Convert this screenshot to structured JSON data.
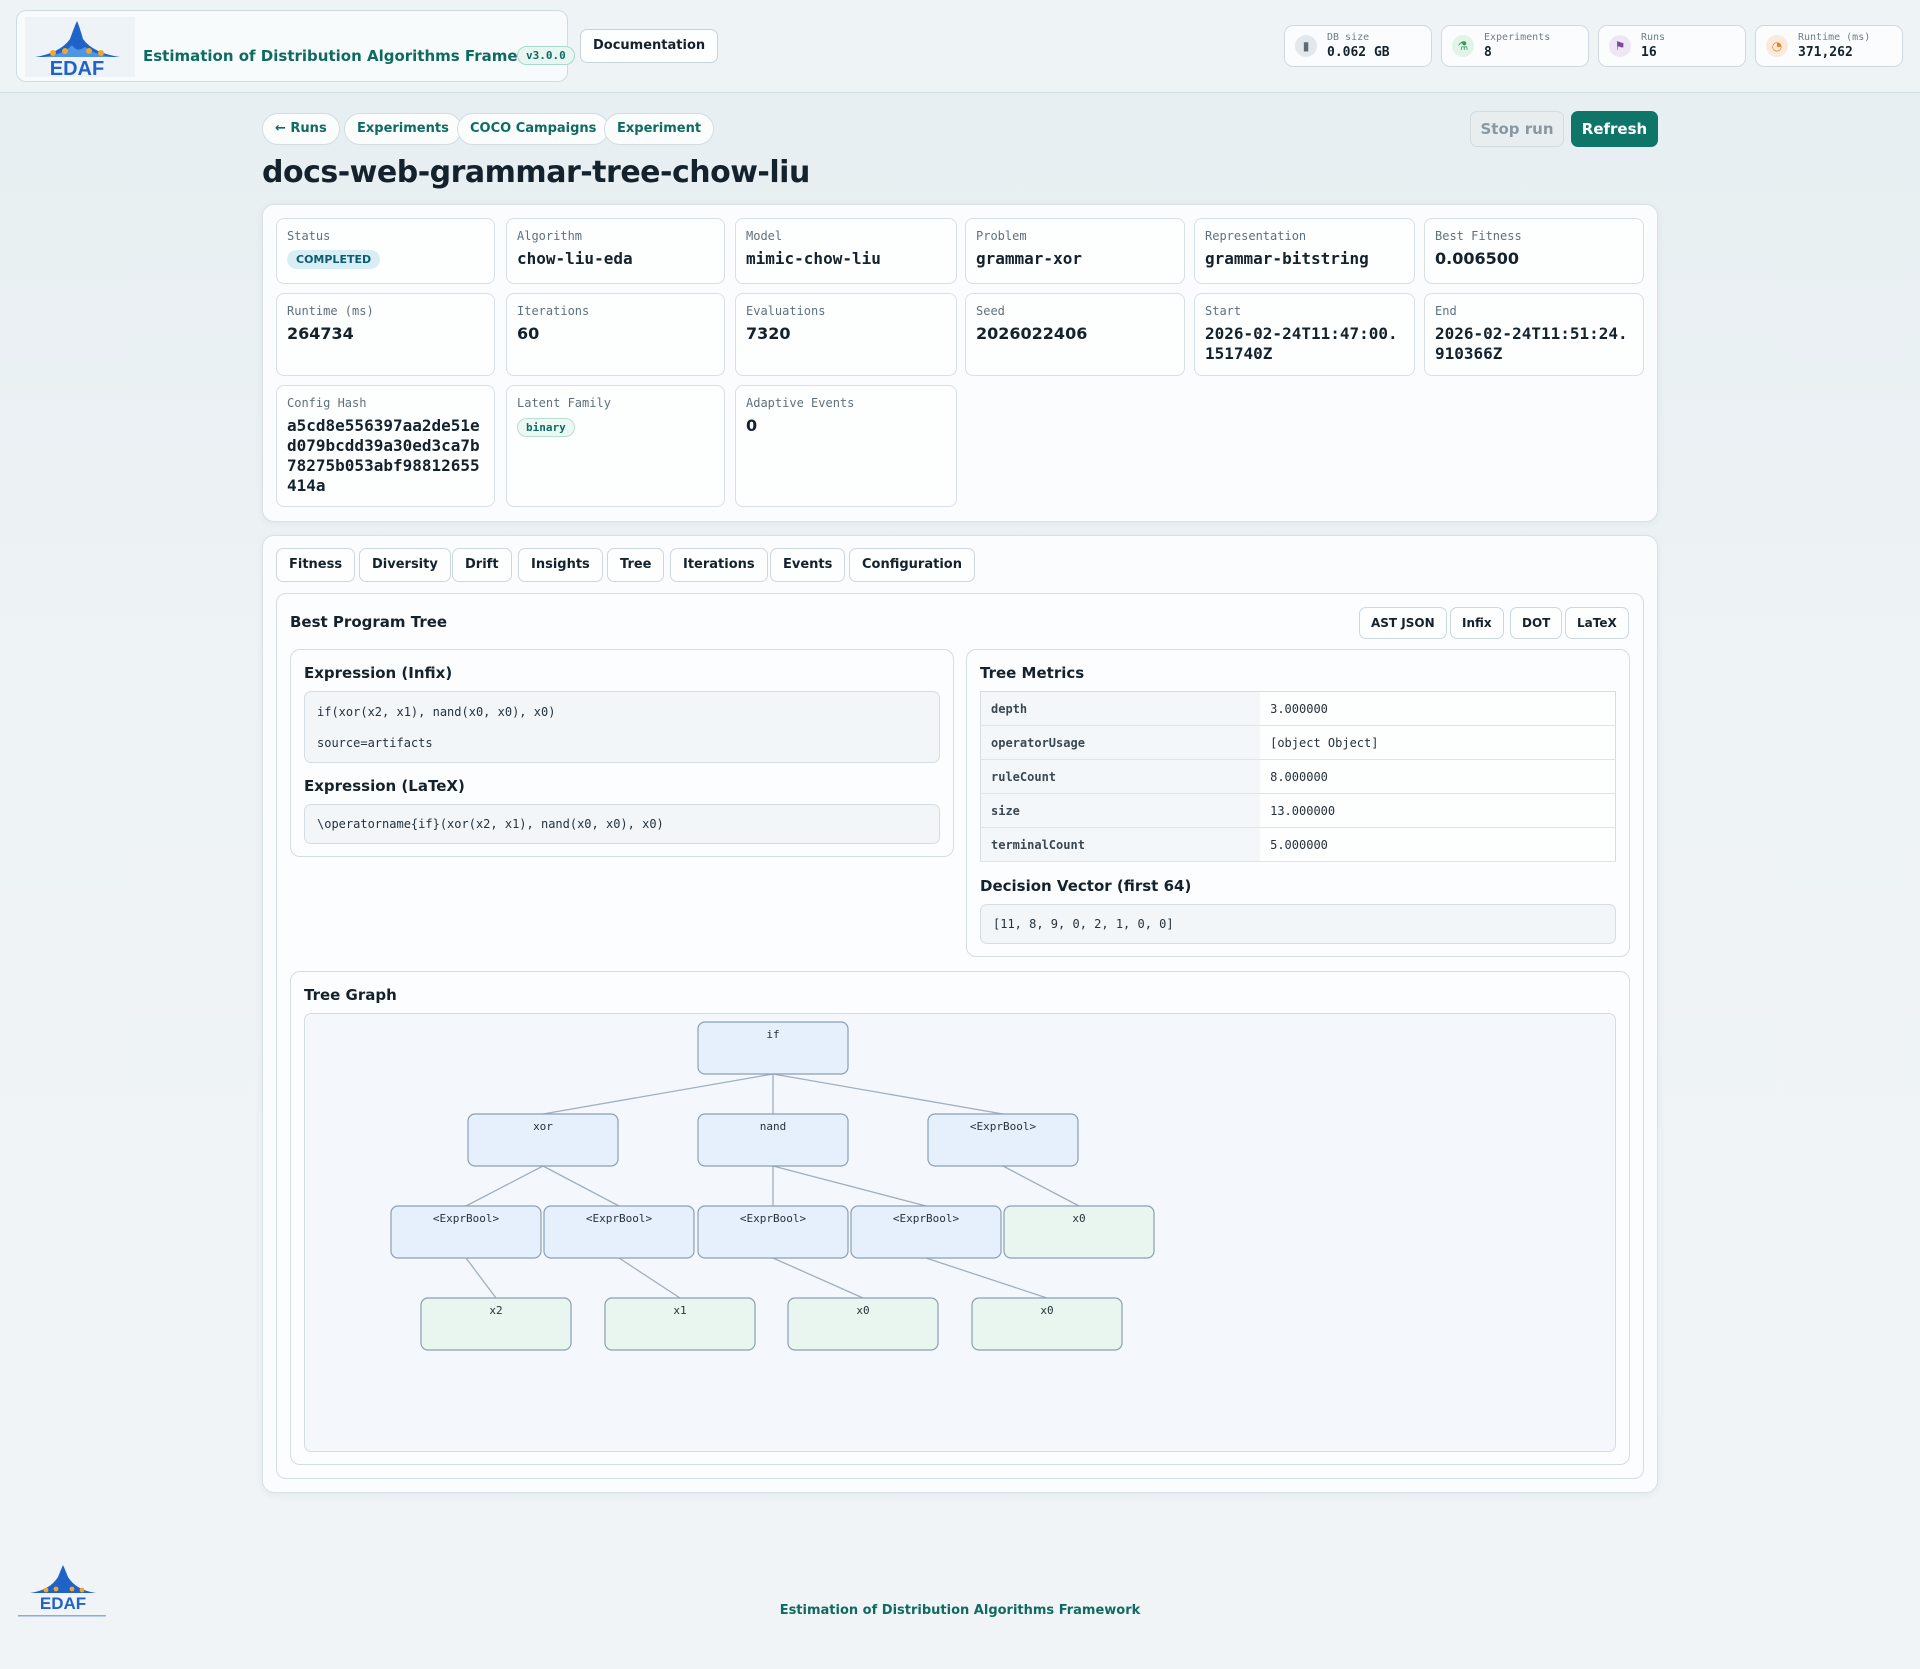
{
  "header": {
    "logo_text": "EDAF",
    "app_title": "Estimation of Distribution Algorithms Framework",
    "version": "v3.0.0",
    "docs_label": "Documentation",
    "stats": [
      {
        "label": "DB size",
        "value": "0.062 GB",
        "icon": "database-icon",
        "color": "#5b6b78"
      },
      {
        "label": "Experiments",
        "value": "8",
        "icon": "flask-icon",
        "color": "#2e9b57"
      },
      {
        "label": "Runs",
        "value": "16",
        "icon": "checkered-flag-icon",
        "color": "#7a4aa0"
      },
      {
        "label": "Runtime (ms)",
        "value": "371,262",
        "icon": "timer-icon",
        "color": "#e0842c"
      }
    ]
  },
  "nav": {
    "back_runs": "← Runs",
    "experiments": "Experiments",
    "coco": "COCO Campaigns",
    "experiment": "Experiment",
    "stop_run": "Stop run",
    "refresh": "Refresh"
  },
  "run": {
    "title": "docs-web-grammar-tree-chow-liu",
    "fields": {
      "status": {
        "label": "Status",
        "value": "COMPLETED"
      },
      "algorithm": {
        "label": "Algorithm",
        "value": "chow-liu-eda"
      },
      "model": {
        "label": "Model",
        "value": "mimic-chow-liu"
      },
      "problem": {
        "label": "Problem",
        "value": "grammar-xor"
      },
      "representation": {
        "label": "Representation",
        "value": "grammar-bitstring"
      },
      "best_fitness": {
        "label": "Best Fitness",
        "value": "0.006500"
      },
      "runtime": {
        "label": "Runtime (ms)",
        "value": "264734"
      },
      "iterations": {
        "label": "Iterations",
        "value": "60"
      },
      "evaluations": {
        "label": "Evaluations",
        "value": "7320"
      },
      "seed": {
        "label": "Seed",
        "value": "2026022406"
      },
      "start": {
        "label": "Start",
        "value": "2026-02-24T11:47:00.151740Z"
      },
      "end": {
        "label": "End",
        "value": "2026-02-24T11:51:24.910366Z"
      },
      "config_hash": {
        "label": "Config Hash",
        "value": "a5cd8e556397aa2de51ed079bcdd39a30ed3ca7b78275b053abf98812655414a"
      },
      "latent_family": {
        "label": "Latent Family",
        "value": "binary"
      },
      "adaptive_events": {
        "label": "Adaptive Events",
        "value": "0"
      }
    }
  },
  "tabs": [
    "Fitness",
    "Diversity",
    "Drift",
    "Insights",
    "Tree",
    "Iterations",
    "Events",
    "Configuration"
  ],
  "tree": {
    "section_title": "Best Program Tree",
    "formats": [
      "AST JSON",
      "Infix",
      "DOT",
      "LaTeX"
    ],
    "infix_title": "Expression (Infix)",
    "infix_expr": "if(xor(x2, x1), nand(x0, x0), x0)",
    "infix_source": "source=artifacts",
    "latex_title": "Expression (LaTeX)",
    "latex_expr": "\\operatorname{if}(xor(x2, x1), nand(x0, x0), x0)",
    "metrics_title": "Tree Metrics",
    "metrics": [
      {
        "key": "depth",
        "value": "3.000000"
      },
      {
        "key": "operatorUsage",
        "value": "[object Object]"
      },
      {
        "key": "ruleCount",
        "value": "8.000000"
      },
      {
        "key": "size",
        "value": "13.000000"
      },
      {
        "key": "terminalCount",
        "value": "5.000000"
      }
    ],
    "decision_title": "Decision Vector (first 64)",
    "decision_vector": "[11, 8, 9, 0, 2, 1, 0, 0]",
    "graph_title": "Tree Graph",
    "graph": {
      "node_colors": {
        "rule": "#e6f0fc",
        "terminal": "#e8f6ef",
        "stroke": "#8aa0b4",
        "edge": "#9fb0bf"
      },
      "nodes": [
        {
          "id": "n0",
          "label": "if",
          "kind": "rule"
        },
        {
          "id": "n1",
          "label": "xor",
          "kind": "rule"
        },
        {
          "id": "n2",
          "label": "nand",
          "kind": "rule"
        },
        {
          "id": "n3",
          "label": "<ExprBool>",
          "kind": "rule"
        },
        {
          "id": "n4",
          "label": "<ExprBool>",
          "kind": "rule"
        },
        {
          "id": "n5",
          "label": "<ExprBool>",
          "kind": "rule"
        },
        {
          "id": "n6",
          "label": "<ExprBool>",
          "kind": "rule"
        },
        {
          "id": "n7",
          "label": "<ExprBool>",
          "kind": "rule"
        },
        {
          "id": "n8",
          "label": "x0",
          "kind": "terminal"
        },
        {
          "id": "n9",
          "label": "x2",
          "kind": "terminal"
        },
        {
          "id": "n10",
          "label": "x1",
          "kind": "terminal"
        },
        {
          "id": "n11",
          "label": "x0",
          "kind": "terminal"
        },
        {
          "id": "n12",
          "label": "x0",
          "kind": "terminal"
        }
      ],
      "edges": [
        [
          "n0",
          "n1"
        ],
        [
          "n0",
          "n2"
        ],
        [
          "n0",
          "n3"
        ],
        [
          "n1",
          "n4"
        ],
        [
          "n1",
          "n5"
        ],
        [
          "n2",
          "n6"
        ],
        [
          "n2",
          "n7"
        ],
        [
          "n3",
          "n8"
        ],
        [
          "n4",
          "n9"
        ],
        [
          "n5",
          "n10"
        ],
        [
          "n6",
          "n11"
        ],
        [
          "n7",
          "n12"
        ]
      ]
    }
  },
  "footer": {
    "logo_text": "EDAF",
    "title": "Estimation of Distribution Algorithms Framework"
  }
}
